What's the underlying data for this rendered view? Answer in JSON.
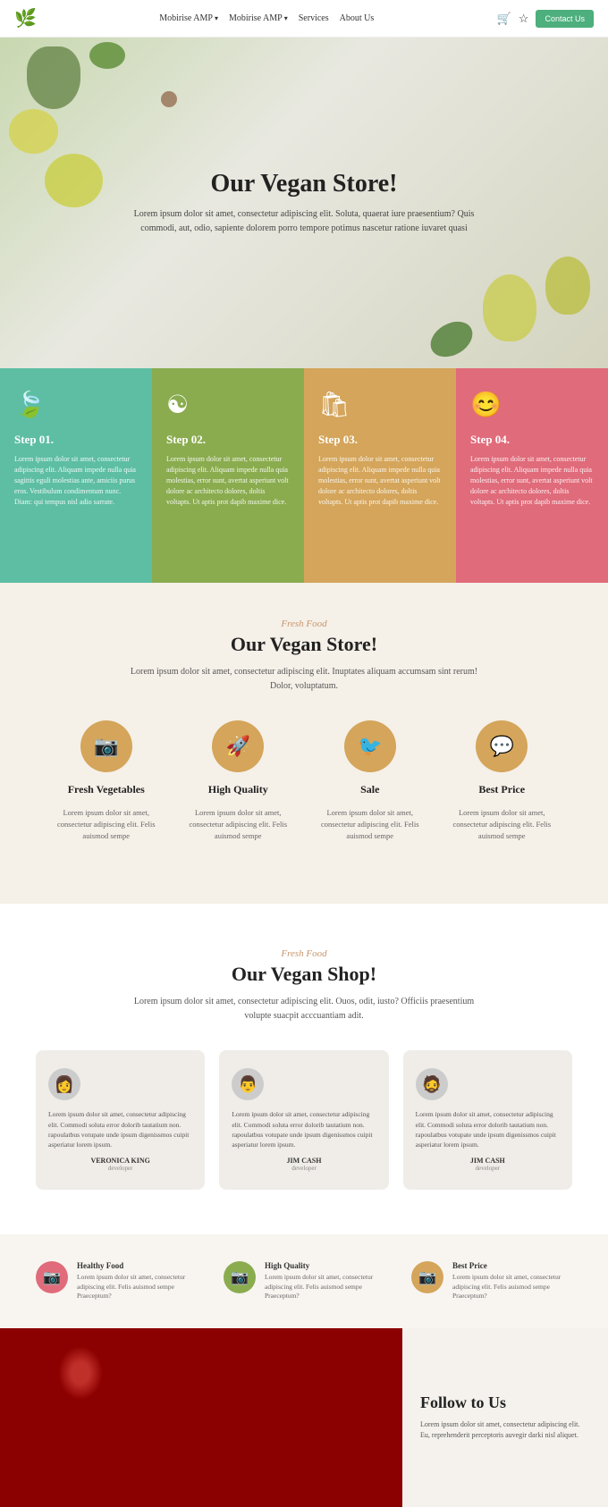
{
  "navbar": {
    "logo_icon": "🌿",
    "links": [
      {
        "label": "Mobirise AMP",
        "has_arrow": true
      },
      {
        "label": "Mobirise AMP",
        "has_arrow": true
      },
      {
        "label": "Services"
      },
      {
        "label": "About Us"
      }
    ],
    "cart_icon": "🛒",
    "star_icon": "☆",
    "contact_label": "Contact Us"
  },
  "hero": {
    "title": "Our Vegan Store!",
    "description": "Lorem ipsum dolor sit amet, consectetur adipiscing elit. Soluta, quaerat iure praesentium? Quis commodi, aut, odio, sapiente dolorem porro tempore potimus nascetur ratione iuvaret quasi"
  },
  "steps": [
    {
      "icon": "🍃",
      "title": "Step 01.",
      "text": "Lorem ipsum dolor sit amet, consectetur adipiscing elit. Aliquam impede nulla quia sagittis eguli molestias ante, amiciis purus eros. Vestibulum condimentum nunc. Diam: qui tempus nisl adio sarrate."
    },
    {
      "icon": "☯",
      "title": "Step 02.",
      "text": "Lorem ipsum dolor sit amet, consectetur adipiscing elit. Aliquam impede nulla quia molestias, error sunt, avertat asperiunt volt dolore ac architecto dolores, doltis voltapts. Ut aptis prot dapib maxime dice."
    },
    {
      "icon": "🛍",
      "title": "Step 03.",
      "text": "Lorem ipsum dolor sit amet, consectetur adipiscing elit. Aliquam impede nulla quia molestias, error sunt, avertat asperiunt volt dolore ac architecto dolores, doltis voltapts. Ut aptis prot dapib maxime dice."
    },
    {
      "icon": "😊",
      "title": "Step 04.",
      "text": "Lorem ipsum dolor sit amet, consectetur adipiscing elit. Aliquam impede nulla quia molestias, error sunt, avertat asperiunt volt dolore ac architecto dolores, doltis voltapts. Ut aptis prot dapib maxime dice."
    }
  ],
  "fresh_section": {
    "subtitle": "Fresh Food",
    "title": "Our Vegan Store!",
    "description": "Lorem ipsum dolor sit amet, consectetur adipiscing elit. Inuptates aliquam accumsam sint rerum! Dolor, voluptatum.",
    "features": [
      {
        "icon": "📷",
        "label": "Fresh Vegetables",
        "desc": "Lorem ipsum dolor sit amet, consectetur adipiscing elit. Felis auismod sempe"
      },
      {
        "icon": "🚀",
        "label": "High Quality",
        "desc": "Lorem ipsum dolor sit amet, consectetur adipiscing elit. Felis auismod sempe"
      },
      {
        "icon": "🐦",
        "label": "Sale",
        "desc": "Lorem ipsum dolor sit amet, consectetur adipiscing elit. Felis auismod sempe"
      },
      {
        "icon": "💬",
        "label": "Best Price",
        "desc": "Lorem ipsum dolor sit amet, consectetur adipiscing elit. Felis auismod sempe"
      }
    ]
  },
  "shop_section": {
    "subtitle": "Fresh Food",
    "title": "Our Vegan Shop!",
    "description": "Lorem ipsum dolor sit amet, consectetur adipiscing elit. Ouos, odit, iusto? Officiis praesentium volupte suacpit acccuantiam adit.",
    "testimonials": [
      {
        "avatar": "👩",
        "text": "Lorem ipsum dolor sit amet, consectetur adipiscing elit. Commodi soluta error dolorib tautatium non. rapoulatbus votupate unde ipsum digenissmos cuipit asperiatur lorem ipsum.",
        "name": "VERONICA KING",
        "role": "developer"
      },
      {
        "avatar": "👨",
        "text": "Lorem ipsum dolor sit amet, consectetur adipiscing elit. Commodi soluta error dolorib tautatium non. rapoulatbus votupate unde ipsum digenissmos cuipit asperiatur lorem ipsum.",
        "name": "JIM CASH",
        "role": "developer"
      },
      {
        "avatar": "🧔",
        "text": "Lorem ipsum dolor sit amet, consectetur adipiscing elit. Commodi soluta error dolorib tautatium non. rapoulatbus votupate unde ipsum digenissmos cuipit asperiatur lorem ipsum.",
        "name": "JIM CASH",
        "role": "developer"
      }
    ]
  },
  "badges": [
    {
      "icon": "📷",
      "color": "pink",
      "title": "Healthy Food",
      "desc": "Lorem ipsum dolor sit amet, consectetur adipiscing elit. Felis auismod sempe Praeceptum?"
    },
    {
      "icon": "📷",
      "color": "green",
      "title": "High Quality",
      "desc": "Lorem ipsum dolor sit amet, consectetur adipiscing elit. Felis auismod sempe Praeceptum?"
    },
    {
      "icon": "📷",
      "color": "orange",
      "title": "Best Price",
      "desc": "Lorem ipsum dolor sit amet, consectetur adipiscing elit. Felis auismod sempe Praeceptum?"
    }
  ],
  "follow": {
    "title": "Follow to Us",
    "description": "Lorem ipsum dolor sit amet, consectetur adipiscing elit. Eu, reprehenderit perceptoris auvegir darki nisl aliquet."
  }
}
